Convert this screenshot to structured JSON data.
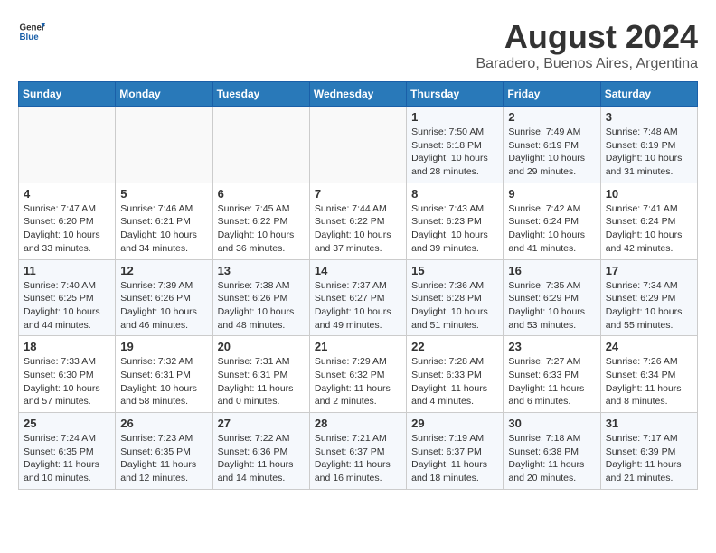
{
  "header": {
    "logo": {
      "general": "General",
      "blue": "Blue"
    },
    "title": "August 2024",
    "subtitle": "Baradero, Buenos Aires, Argentina"
  },
  "weekdays": [
    "Sunday",
    "Monday",
    "Tuesday",
    "Wednesday",
    "Thursday",
    "Friday",
    "Saturday"
  ],
  "weeks": [
    [
      {
        "day": "",
        "info": ""
      },
      {
        "day": "",
        "info": ""
      },
      {
        "day": "",
        "info": ""
      },
      {
        "day": "",
        "info": ""
      },
      {
        "day": "1",
        "info": "Sunrise: 7:50 AM\nSunset: 6:18 PM\nDaylight: 10 hours and 28 minutes."
      },
      {
        "day": "2",
        "info": "Sunrise: 7:49 AM\nSunset: 6:19 PM\nDaylight: 10 hours and 29 minutes."
      },
      {
        "day": "3",
        "info": "Sunrise: 7:48 AM\nSunset: 6:19 PM\nDaylight: 10 hours and 31 minutes."
      }
    ],
    [
      {
        "day": "4",
        "info": "Sunrise: 7:47 AM\nSunset: 6:20 PM\nDaylight: 10 hours and 33 minutes."
      },
      {
        "day": "5",
        "info": "Sunrise: 7:46 AM\nSunset: 6:21 PM\nDaylight: 10 hours and 34 minutes."
      },
      {
        "day": "6",
        "info": "Sunrise: 7:45 AM\nSunset: 6:22 PM\nDaylight: 10 hours and 36 minutes."
      },
      {
        "day": "7",
        "info": "Sunrise: 7:44 AM\nSunset: 6:22 PM\nDaylight: 10 hours and 37 minutes."
      },
      {
        "day": "8",
        "info": "Sunrise: 7:43 AM\nSunset: 6:23 PM\nDaylight: 10 hours and 39 minutes."
      },
      {
        "day": "9",
        "info": "Sunrise: 7:42 AM\nSunset: 6:24 PM\nDaylight: 10 hours and 41 minutes."
      },
      {
        "day": "10",
        "info": "Sunrise: 7:41 AM\nSunset: 6:24 PM\nDaylight: 10 hours and 42 minutes."
      }
    ],
    [
      {
        "day": "11",
        "info": "Sunrise: 7:40 AM\nSunset: 6:25 PM\nDaylight: 10 hours and 44 minutes."
      },
      {
        "day": "12",
        "info": "Sunrise: 7:39 AM\nSunset: 6:26 PM\nDaylight: 10 hours and 46 minutes."
      },
      {
        "day": "13",
        "info": "Sunrise: 7:38 AM\nSunset: 6:26 PM\nDaylight: 10 hours and 48 minutes."
      },
      {
        "day": "14",
        "info": "Sunrise: 7:37 AM\nSunset: 6:27 PM\nDaylight: 10 hours and 49 minutes."
      },
      {
        "day": "15",
        "info": "Sunrise: 7:36 AM\nSunset: 6:28 PM\nDaylight: 10 hours and 51 minutes."
      },
      {
        "day": "16",
        "info": "Sunrise: 7:35 AM\nSunset: 6:29 PM\nDaylight: 10 hours and 53 minutes."
      },
      {
        "day": "17",
        "info": "Sunrise: 7:34 AM\nSunset: 6:29 PM\nDaylight: 10 hours and 55 minutes."
      }
    ],
    [
      {
        "day": "18",
        "info": "Sunrise: 7:33 AM\nSunset: 6:30 PM\nDaylight: 10 hours and 57 minutes."
      },
      {
        "day": "19",
        "info": "Sunrise: 7:32 AM\nSunset: 6:31 PM\nDaylight: 10 hours and 58 minutes."
      },
      {
        "day": "20",
        "info": "Sunrise: 7:31 AM\nSunset: 6:31 PM\nDaylight: 11 hours and 0 minutes."
      },
      {
        "day": "21",
        "info": "Sunrise: 7:29 AM\nSunset: 6:32 PM\nDaylight: 11 hours and 2 minutes."
      },
      {
        "day": "22",
        "info": "Sunrise: 7:28 AM\nSunset: 6:33 PM\nDaylight: 11 hours and 4 minutes."
      },
      {
        "day": "23",
        "info": "Sunrise: 7:27 AM\nSunset: 6:33 PM\nDaylight: 11 hours and 6 minutes."
      },
      {
        "day": "24",
        "info": "Sunrise: 7:26 AM\nSunset: 6:34 PM\nDaylight: 11 hours and 8 minutes."
      }
    ],
    [
      {
        "day": "25",
        "info": "Sunrise: 7:24 AM\nSunset: 6:35 PM\nDaylight: 11 hours and 10 minutes."
      },
      {
        "day": "26",
        "info": "Sunrise: 7:23 AM\nSunset: 6:35 PM\nDaylight: 11 hours and 12 minutes."
      },
      {
        "day": "27",
        "info": "Sunrise: 7:22 AM\nSunset: 6:36 PM\nDaylight: 11 hours and 14 minutes."
      },
      {
        "day": "28",
        "info": "Sunrise: 7:21 AM\nSunset: 6:37 PM\nDaylight: 11 hours and 16 minutes."
      },
      {
        "day": "29",
        "info": "Sunrise: 7:19 AM\nSunset: 6:37 PM\nDaylight: 11 hours and 18 minutes."
      },
      {
        "day": "30",
        "info": "Sunrise: 7:18 AM\nSunset: 6:38 PM\nDaylight: 11 hours and 20 minutes."
      },
      {
        "day": "31",
        "info": "Sunrise: 7:17 AM\nSunset: 6:39 PM\nDaylight: 11 hours and 21 minutes."
      }
    ]
  ]
}
